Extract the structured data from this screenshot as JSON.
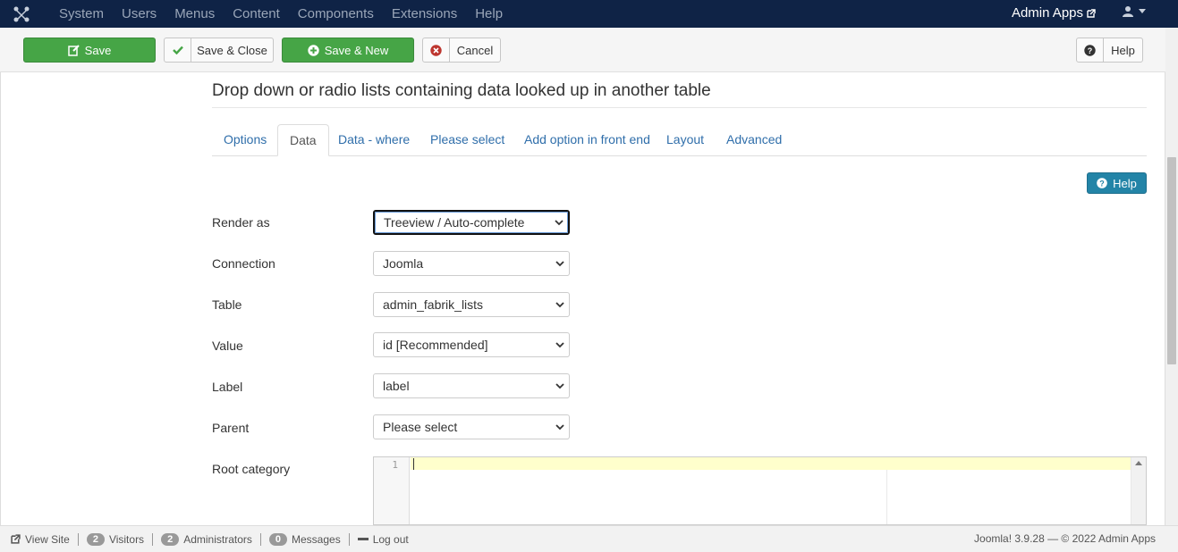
{
  "topnav": {
    "logo_icon": "joomla-icon",
    "menu": [
      "System",
      "Users",
      "Menus",
      "Content",
      "Components",
      "Extensions",
      "Help"
    ],
    "site_name": "Admin Apps",
    "site_link_icon": "external-link-icon",
    "user_icon": "user-icon"
  },
  "toolbar": {
    "save": "Save",
    "save_close": "Save & Close",
    "save_new": "Save & New",
    "cancel": "Cancel",
    "help": "Help"
  },
  "page": {
    "title": "Drop down or radio lists containing data looked up in another table",
    "help_button": "Help"
  },
  "tabs": [
    {
      "label": "Options",
      "active": false
    },
    {
      "label": "Data",
      "active": true
    },
    {
      "label": "Data - where",
      "active": false
    },
    {
      "label": "Please select",
      "active": false
    },
    {
      "label": "Add option in front end",
      "active": false
    },
    {
      "label": "Layout",
      "active": false
    },
    {
      "label": "Advanced",
      "active": false
    }
  ],
  "form": {
    "render_as": {
      "label": "Render as",
      "value": "Treeview / Auto-complete"
    },
    "connection": {
      "label": "Connection",
      "value": "Joomla"
    },
    "table": {
      "label": "Table",
      "value": "admin_fabrik_lists"
    },
    "value": {
      "label": "Value",
      "value": "id [Recommended]"
    },
    "label": {
      "label": "Label",
      "value": "label"
    },
    "parent": {
      "label": "Parent",
      "value": "Please select"
    },
    "root_category": {
      "label": "Root category",
      "line_number": "1"
    }
  },
  "statusbar": {
    "view_site": "View Site",
    "visitors_count": "2",
    "visitors": "Visitors",
    "admins_count": "2",
    "admins": "Administrators",
    "messages_count": "0",
    "messages": "Messages",
    "logout": "Log out",
    "copyright": "Joomla! 3.9.28 — © 2022 Admin Apps"
  },
  "colors": {
    "navbar": "#0f2346",
    "success": "#46a546",
    "danger": "#bd362f",
    "info": "#2384a7",
    "link": "#2f6eaa"
  }
}
